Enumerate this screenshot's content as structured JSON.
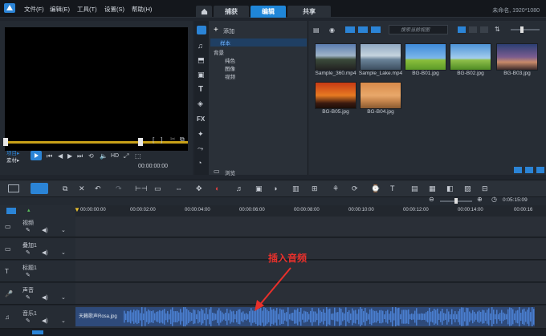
{
  "menubar": {
    "file": "文件(F)",
    "edit": "编辑(E)",
    "tools": "工具(T)",
    "settings": "设置(S)",
    "help": "帮助(H)"
  },
  "tabs": {
    "capture": "捕获",
    "edit": "编辑",
    "share": "共享"
  },
  "resolution": "未命名, 1920*1080",
  "preview": {
    "project_label": "项目▸",
    "clip_label": "素材▸",
    "hd_label": "HD",
    "timecode": "00:00:00:00"
  },
  "library": {
    "add_label": "添加",
    "tree": {
      "sample": "样本",
      "background": "背景",
      "solid": "纯色",
      "image": "图像",
      "video": "视频"
    },
    "browse_label": "浏览",
    "search_placeholder": "搜索当前视图",
    "items": [
      {
        "label": "Sample_360.mp4"
      },
      {
        "label": "Sample_Lake.mp4"
      },
      {
        "label": "BG-B01.jpg"
      },
      {
        "label": "BG-B02.jpg"
      },
      {
        "label": "BG-B03.jpg"
      },
      {
        "label": "BG-B05.jpg"
      },
      {
        "label": "BG-B04.jpg"
      }
    ]
  },
  "timeline": {
    "zoom_time": "0:05:15:09",
    "ruler": [
      "00:00:00:00",
      "00:00:02:00",
      "00:00:04:00",
      "00:00:06:00",
      "00:00:08:00",
      "00:00:10:00",
      "00:00:12:00",
      "00:00:14:00",
      "00:00:16"
    ],
    "tracks": {
      "video": "视频",
      "overlay": "叠加1",
      "title": "标题1",
      "voice": "声音",
      "music": "音乐1"
    },
    "audio_clip": "天籁歌声Rosa.jpg",
    "annotation": "插入音频"
  },
  "colors": {
    "accent": "#1f86d8",
    "waveform": "#4a7fd0",
    "annotation": "#e8302b"
  }
}
